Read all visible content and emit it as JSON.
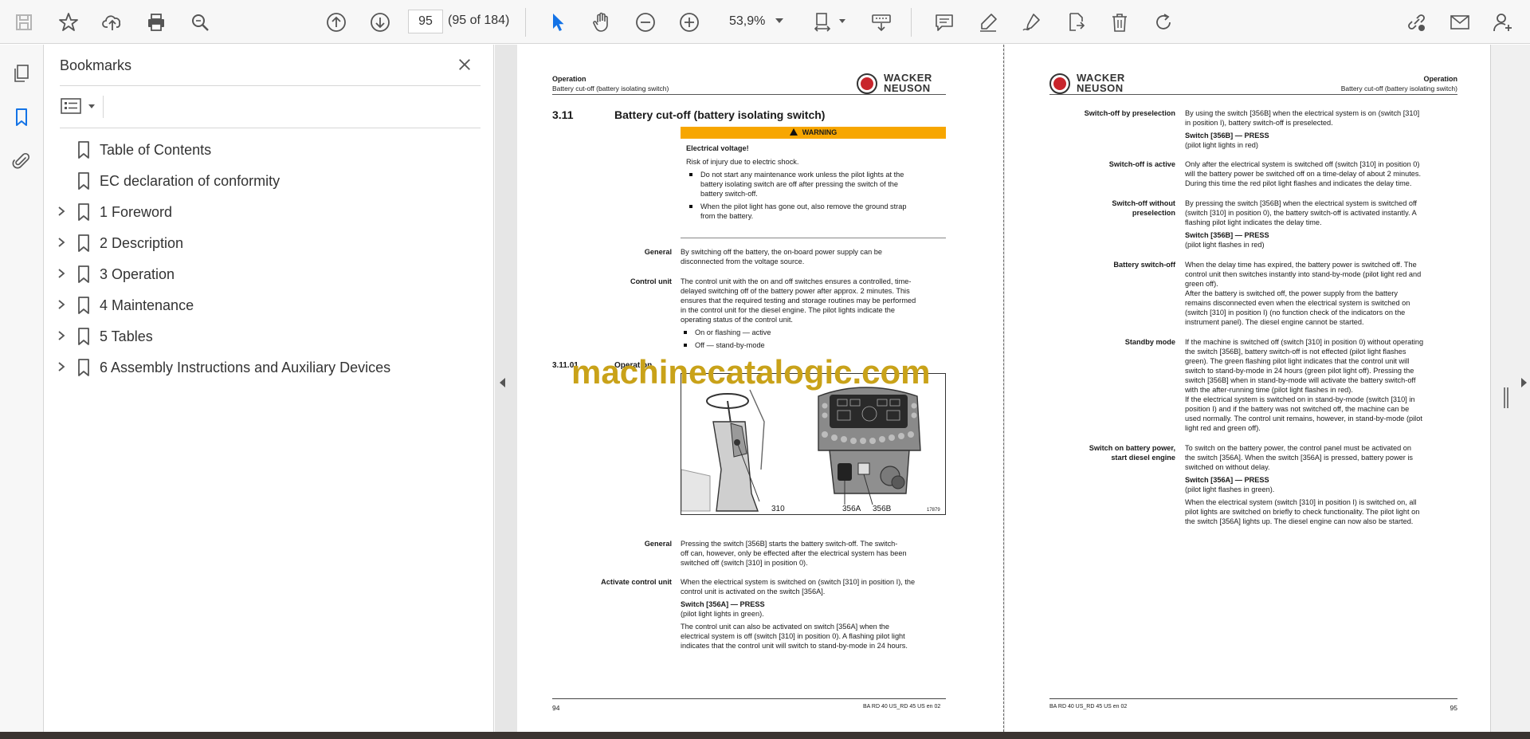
{
  "toolbar": {
    "page_number": "95",
    "page_count": "(95 of 184)",
    "zoom": "53,9%"
  },
  "bookmarks": {
    "title": "Bookmarks",
    "items": [
      {
        "label": "Table of Contents",
        "expandable": false
      },
      {
        "label": "EC declaration of conformity",
        "expandable": false
      },
      {
        "label": "1 Foreword",
        "expandable": true
      },
      {
        "label": "2 Description",
        "expandable": true
      },
      {
        "label": "3 Operation",
        "expandable": true
      },
      {
        "label": "4 Maintenance",
        "expandable": true
      },
      {
        "label": "5 Tables",
        "expandable": true
      },
      {
        "label": "6 Assembly Instructions and Auxiliary Devices",
        "expandable": true
      }
    ]
  },
  "brand": {
    "line1": "WACKER",
    "line2": "NEUSON"
  },
  "left_page": {
    "header_section": "Operation",
    "header_sub": "Battery cut-off (battery isolating switch)",
    "heading_number": "3.11",
    "heading_title": "Battery cut-off (battery isolating switch)",
    "warning_label": "WARNING",
    "warning_title": "Electrical voltage!",
    "warning_text": "Risk of injury due to electric shock.",
    "warning_bullet1_l1": "Do not start any maintenance work unless the pilot lights at the",
    "warning_bullet1_l2": "battery isolating switch are off after pressing the switch of the",
    "warning_bullet1_l3": "battery switch-off.",
    "warning_bullet2_l1": "When the pilot light has gone out, also remove the ground strap",
    "warning_bullet2_l2": "from the battery.",
    "general_label": "General",
    "general_l1": "By switching off the battery, the on-board power supply can be",
    "general_l2": "disconnected from the voltage source.",
    "control_label": "Control unit",
    "control_l1": "The control unit with the on and off switches ensures a controlled, time-",
    "control_l2": "delayed switching off of the battery power after approx. 2 minutes. This",
    "control_l3": "ensures that the required testing and storage routines may be performed",
    "control_l4": "in the control unit for the diesel engine. The pilot lights indicate the",
    "control_l5": "operating status of the control unit.",
    "control_bullet1": "On or flashing — active",
    "control_bullet2": "Off — stand-by-mode",
    "sub_number": "3.11.01",
    "sub_title": "Operation",
    "fig_label_310": "310",
    "fig_label_356a": "356A",
    "fig_label_356b": "356B",
    "fig_id": "17879",
    "general2_label": "General",
    "general2_l1": "Pressing the switch [356B] starts the battery switch-off. The switch-",
    "general2_l2": "off can, however, only be effected after the electrical system has been",
    "general2_l3": "switched off (switch [310] in position 0).",
    "activate_label": "Activate control unit",
    "activate_l1": "When the electrical system is switched on (switch [310] in position I), the",
    "activate_l2": "control unit is activated on the switch [356A].",
    "activate_press": "Switch [356A] — PRESS",
    "activate_press_note": "(pilot light lights in green).",
    "activate_p2_l1": "The control unit can also be activated on switch [356A] when the",
    "activate_p2_l2": "electrical system is off (switch [310] in position 0). A flashing pilot light",
    "activate_p2_l3": "indicates that the control unit will switch to stand-by-mode in 24 hours.",
    "footer_page": "94",
    "footer_doc": "BA RD 40 US_RD 45 US en 02"
  },
  "right_page": {
    "header_section": "Operation",
    "header_sub": "Battery cut-off (battery isolating switch)",
    "pre_label": "Switch-off by preselection",
    "pre_l1": "By using the switch [356B] when the electrical system is on (switch [310]",
    "pre_l2": "in position I), battery switch-off is preselected.",
    "pre_press": "Switch [356B] — PRESS",
    "pre_note": "(pilot light lights in red)",
    "active_label": "Switch-off is active",
    "active_l1": "Only after the electrical system is switched off (switch [310] in position 0)",
    "active_l2": "will the battery power be switched off on a time-delay of about 2 minutes.",
    "active_l3": "During this time the red pilot light flashes and indicates the delay time.",
    "nopre_label_l1": "Switch-off without",
    "nopre_label_l2": "preselection",
    "nopre_l1": "By pressing the switch [356B] when the electrical system is switched off",
    "nopre_l2": "(switch [310] in position 0), the battery switch-off is activated instantly. A",
    "nopre_l3": "flashing pilot light indicates the delay time.",
    "nopre_press": "Switch [356B] — PRESS",
    "nopre_note": "(pilot light flashes in red)",
    "bso_label": "Battery switch-off",
    "bso_l1": "When the delay time has expired, the battery power is switched off. The",
    "bso_l2": "control unit then switches instantly into stand-by-mode (pilot light red and",
    "bso_l3": "green off).",
    "bso_l4": "After the battery is switched off, the power supply from the battery",
    "bso_l5": "remains disconnected even when the electrical system is switched on",
    "bso_l6": "(switch [310] in position I) (no function check of the indicators on the",
    "bso_l7": "instrument panel). The diesel engine cannot be started.",
    "sb_label": "Standby mode",
    "sb_l1": "If the machine is switched off (switch [310] in position 0) without operating",
    "sb_l2": "the switch [356B], battery switch-off is not effected (pilot light flashes",
    "sb_l3": "green). The green flashing pilot light indicates that the control unit will",
    "sb_l4": "switch to stand-by-mode in 24 hours (green pilot light off). Pressing the",
    "sb_l5": "switch [356B] when in stand-by-mode will activate the battery switch-off",
    "sb_l6": "with the after-running time (pilot light flashes in red).",
    "sb_l7": "If the electrical system is switched on in stand-by-mode (switch [310] in",
    "sb_l8": "position I) and if the battery was not switched off, the machine can be",
    "sb_l9": "used normally. The control unit remains, however, in stand-by-mode (pilot",
    "sb_l10": "light red and green off).",
    "son_label_l1": "Switch on battery power,",
    "son_label_l2": "start diesel engine",
    "son_l1": "To switch on the battery power, the control panel must be activated on",
    "son_l2": "the switch [356A]. When the switch [356A] is pressed, battery power is",
    "son_l3": "switched on without delay.",
    "son_press": "Switch [356A] — PRESS",
    "son_note": "(pilot light flashes in green).",
    "son_p2_l1": "When the electrical system (switch [310] in position I) is switched on, all",
    "son_p2_l2": "pilot lights are switched on briefly to check functionality. The pilot light on",
    "son_p2_l3": "the switch [356A] lights up. The diesel engine can now also be started.",
    "footer_doc": "BA RD 40 US_RD 45 US en 02",
    "footer_page": "95"
  },
  "watermark": "machinecatalogic.com",
  "colors": {
    "warning": "#f7a600",
    "accent_blue": "#1473e6",
    "watermark": "#c9a219"
  }
}
